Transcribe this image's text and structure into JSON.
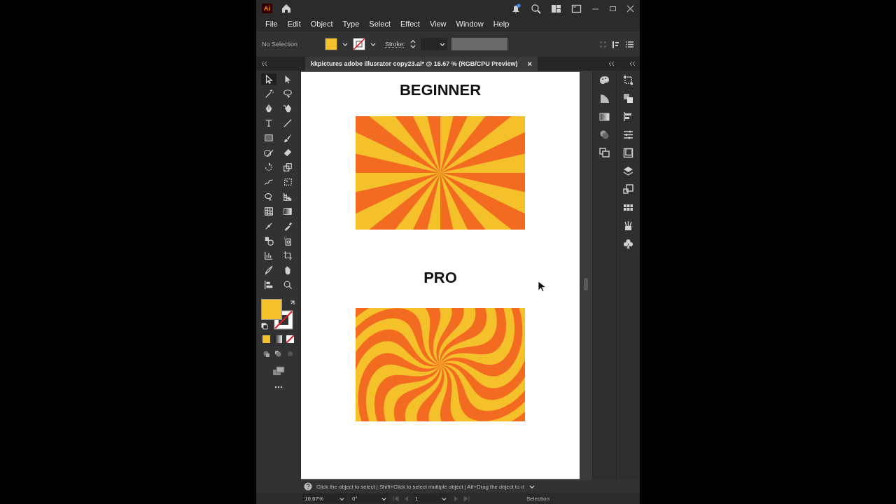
{
  "window": {
    "app_badge": "Ai"
  },
  "menu": [
    {
      "label": "File"
    },
    {
      "label": "Edit"
    },
    {
      "label": "Object"
    },
    {
      "label": "Type"
    },
    {
      "label": "Select"
    },
    {
      "label": "Effect"
    },
    {
      "label": "View"
    },
    {
      "label": "Window"
    },
    {
      "label": "Help"
    }
  ],
  "control_bar": {
    "selection": "No Selection",
    "stroke_label": "Stroke:"
  },
  "document_tab": {
    "title": "kkpictures adobe illusrator copy23.ai* @ 16.67 % (RGB/CPU Preview)",
    "close": "×"
  },
  "toolbar": {
    "tools": [
      {
        "selected": true
      },
      {
        "selected": false
      },
      {
        "selected": false
      },
      {
        "selected": false
      },
      {
        "selected": false
      },
      {
        "selected": false
      },
      {
        "selected": false
      },
      {
        "selected": false
      },
      {
        "selected": false
      },
      {
        "selected": false
      },
      {
        "selected": false
      },
      {
        "selected": false
      },
      {
        "selected": false
      },
      {
        "selected": false
      },
      {
        "selected": false
      },
      {
        "selected": false
      },
      {
        "selected": false
      },
      {
        "selected": false
      },
      {
        "selected": false
      },
      {
        "selected": false
      },
      {
        "selected": false
      },
      {
        "selected": false
      },
      {
        "selected": false
      },
      {
        "selected": false
      },
      {
        "selected": false
      },
      {
        "selected": false
      },
      {
        "selected": false
      },
      {
        "selected": false
      },
      {
        "selected": false
      },
      {
        "selected": false
      }
    ]
  },
  "artboard": {
    "sections": [
      {
        "heading": "BEGINNER",
        "kind": "straight"
      },
      {
        "heading": "PRO",
        "kind": "swirl"
      }
    ]
  },
  "status_hint": "Click the object to select  |  Shift+Click to select multiple object  |  Alt+Drag the object to d",
  "bottom_bar": {
    "zoom": "16.67%",
    "rotation": "0°",
    "artboard_number": "1",
    "tool_name": "Selection"
  }
}
